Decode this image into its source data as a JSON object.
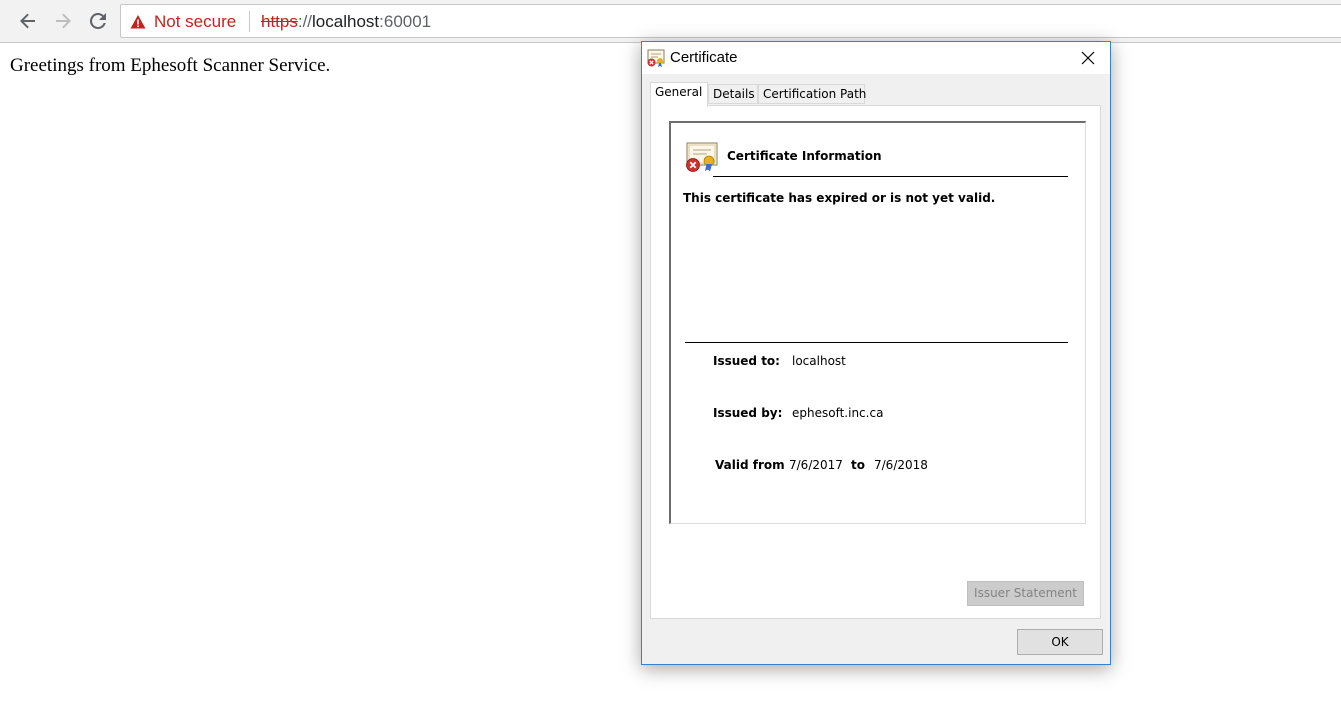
{
  "browser": {
    "security_label": "Not secure",
    "url_scheme": "https",
    "url_separator": "://",
    "url_host": "localhost",
    "url_port": ":60001",
    "icons": [
      "back-arrow-icon",
      "forward-arrow-icon",
      "reload-icon",
      "warning-triangle-icon"
    ]
  },
  "page": {
    "greeting": "Greetings from Ephesoft Scanner Service."
  },
  "dialog": {
    "title": "Certificate",
    "tabs": [
      {
        "label": "General",
        "active": true
      },
      {
        "label": "Details",
        "active": false
      },
      {
        "label": "Certification Path",
        "active": false
      }
    ],
    "info_heading": "Certificate Information",
    "status_message": "This certificate has expired or is not yet valid.",
    "issued_to_label": "Issued to:",
    "issued_to_value": "localhost",
    "issued_by_label": "Issued by:",
    "issued_by_value": "ephesoft.inc.ca",
    "valid_from_label": "Valid from",
    "valid_from_value": "7/6/2017",
    "valid_to_label": "to",
    "valid_to_value": "7/6/2018",
    "issuer_statement_label": "Issuer Statement",
    "ok_label": "OK"
  },
  "colors": {
    "warning_red": "#c5221f",
    "dialog_border": "#3b7fcf",
    "dialog_bg": "#f0f0f0"
  }
}
